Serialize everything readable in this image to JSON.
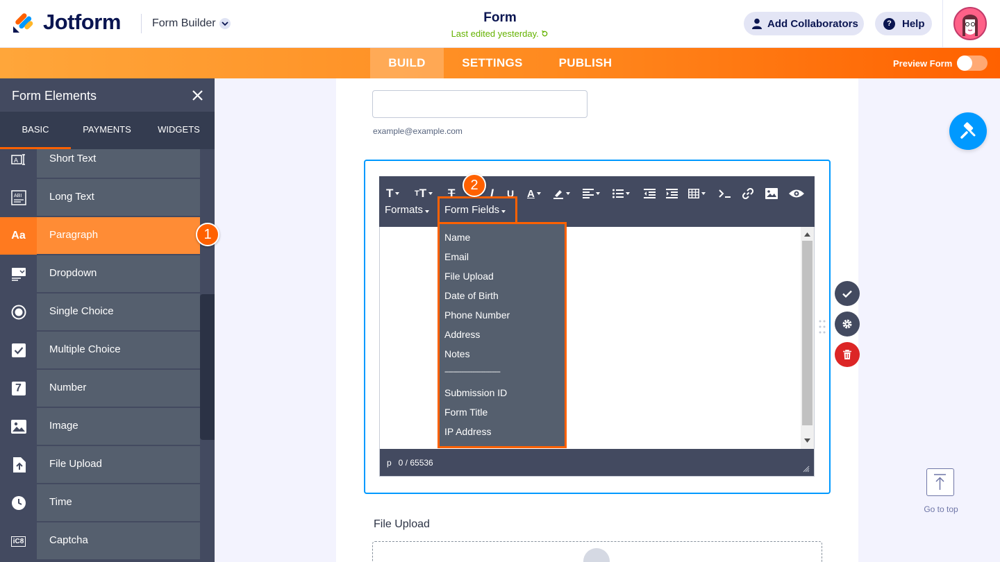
{
  "header": {
    "brand": "Jotform",
    "builder_label": "Form Builder",
    "form_title": "Form",
    "last_edited": "Last edited yesterday.",
    "collaborators_label": "Add Collaborators",
    "help_label": "Help",
    "help_glyph": "?"
  },
  "nav": {
    "tabs": [
      {
        "label": "BUILD",
        "active": true
      },
      {
        "label": "SETTINGS",
        "active": false
      },
      {
        "label": "PUBLISH",
        "active": false
      }
    ],
    "preview_label": "Preview Form",
    "preview_on": false
  },
  "sidebar": {
    "title": "Form Elements",
    "tabs": [
      "BASIC",
      "PAYMENTS",
      "WIDGETS"
    ],
    "items": [
      {
        "label": "Short Text",
        "icon": "short-text-icon"
      },
      {
        "label": "Long Text",
        "icon": "long-text-icon"
      },
      {
        "label": "Paragraph",
        "icon": "paragraph-icon",
        "icon_text": "Aa",
        "active": true
      },
      {
        "label": "Dropdown",
        "icon": "dropdown-icon"
      },
      {
        "label": "Single Choice",
        "icon": "radio-icon"
      },
      {
        "label": "Multiple Choice",
        "icon": "checkbox-icon"
      },
      {
        "label": "Number",
        "icon": "number-icon",
        "icon_text": "7"
      },
      {
        "label": "Image",
        "icon": "image-icon"
      },
      {
        "label": "File Upload",
        "icon": "file-upload-icon"
      },
      {
        "label": "Time",
        "icon": "clock-icon"
      },
      {
        "label": "Captcha",
        "icon": "captcha-icon",
        "icon_text": "iC8"
      }
    ]
  },
  "badges": {
    "step1": "1",
    "step2": "2"
  },
  "canvas": {
    "email_hint": "example@example.com",
    "editor": {
      "formats_label": "Formats",
      "form_fields_label": "Form Fields",
      "status": "p   0 / 65536",
      "dropdown_items": [
        "Name",
        "Email",
        "File Upload",
        "Date of Birth",
        "Phone Number",
        "Address",
        "Notes",
        "------------------------------",
        "Submission ID",
        "Form Title",
        "IP Address"
      ]
    },
    "file_upload_label": "File Upload"
  },
  "right_rail": {
    "go_to_top": "Go to top"
  },
  "colors": {
    "accent_orange": "#ff6100",
    "accent_blue": "#0099ff",
    "sidebar_bg": "#434a60",
    "delete_red": "#dc2626"
  }
}
